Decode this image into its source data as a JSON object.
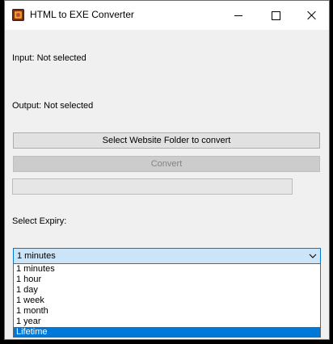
{
  "window": {
    "title": "HTML to EXE Converter",
    "icon": "app-icon"
  },
  "main": {
    "input_label": "Input: Not selected",
    "output_label": "Output: Not selected",
    "select_folder_button": "Select Website Folder to convert",
    "convert_button": "Convert",
    "convert_enabled": false,
    "progress": 0,
    "expiry_label": "Select Expiry:"
  },
  "expiry": {
    "selected_value": "1 minutes",
    "options": [
      "1 minutes",
      "1 hour",
      "1 day",
      "1 week",
      "1 month",
      "1 year",
      "Lifetime"
    ],
    "highlighted_option": "Lifetime"
  },
  "colors": {
    "accent": "#0078d7",
    "combo_focus_bg": "#cce4f7",
    "window_bg": "#f0f0f0",
    "disabled_text": "#838383"
  }
}
